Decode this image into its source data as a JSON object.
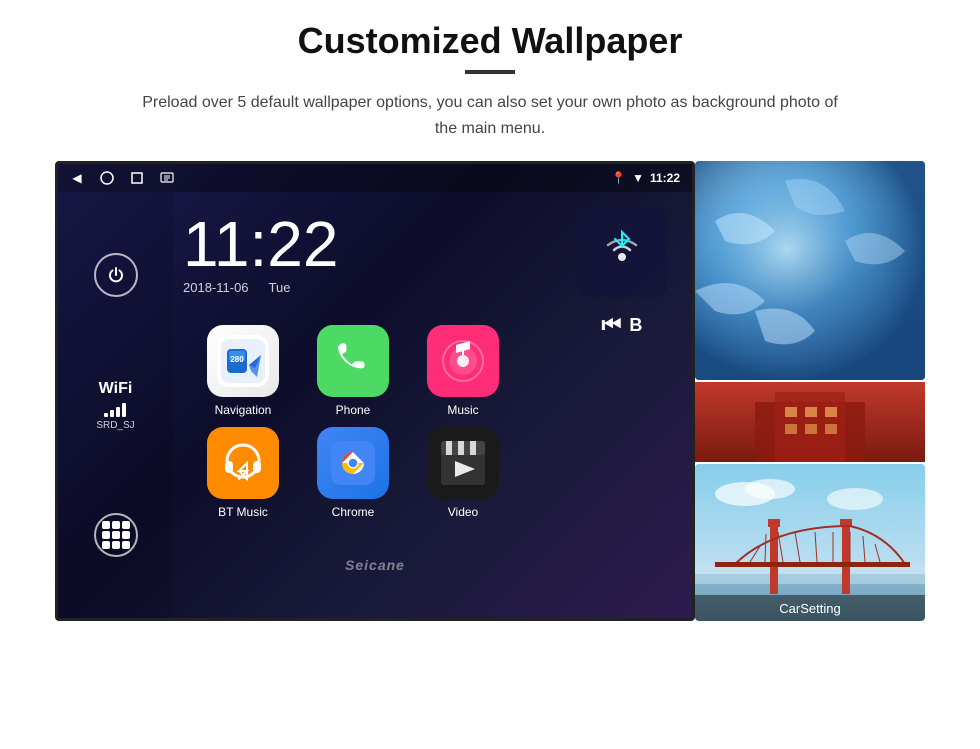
{
  "page": {
    "title": "Customized Wallpaper",
    "subtitle": "Preload over 5 default wallpaper options, you can also set your own photo as background photo of the main menu."
  },
  "statusbar": {
    "time": "11:22",
    "location_icon": "📍",
    "wifi_icon": "▼"
  },
  "clock": {
    "time": "11:22",
    "date": "2018-11-06",
    "day": "Tue"
  },
  "wifi": {
    "label": "WiFi",
    "ssid": "SRD_SJ"
  },
  "apps": [
    {
      "name": "Navigation",
      "type": "navigation"
    },
    {
      "name": "Phone",
      "type": "phone"
    },
    {
      "name": "Music",
      "type": "music"
    },
    {
      "name": "BT Music",
      "type": "btmusic"
    },
    {
      "name": "Chrome",
      "type": "chrome"
    },
    {
      "name": "Video",
      "type": "video"
    }
  ],
  "carsetting": {
    "label": "CarSetting"
  },
  "watermark": "Seicane"
}
